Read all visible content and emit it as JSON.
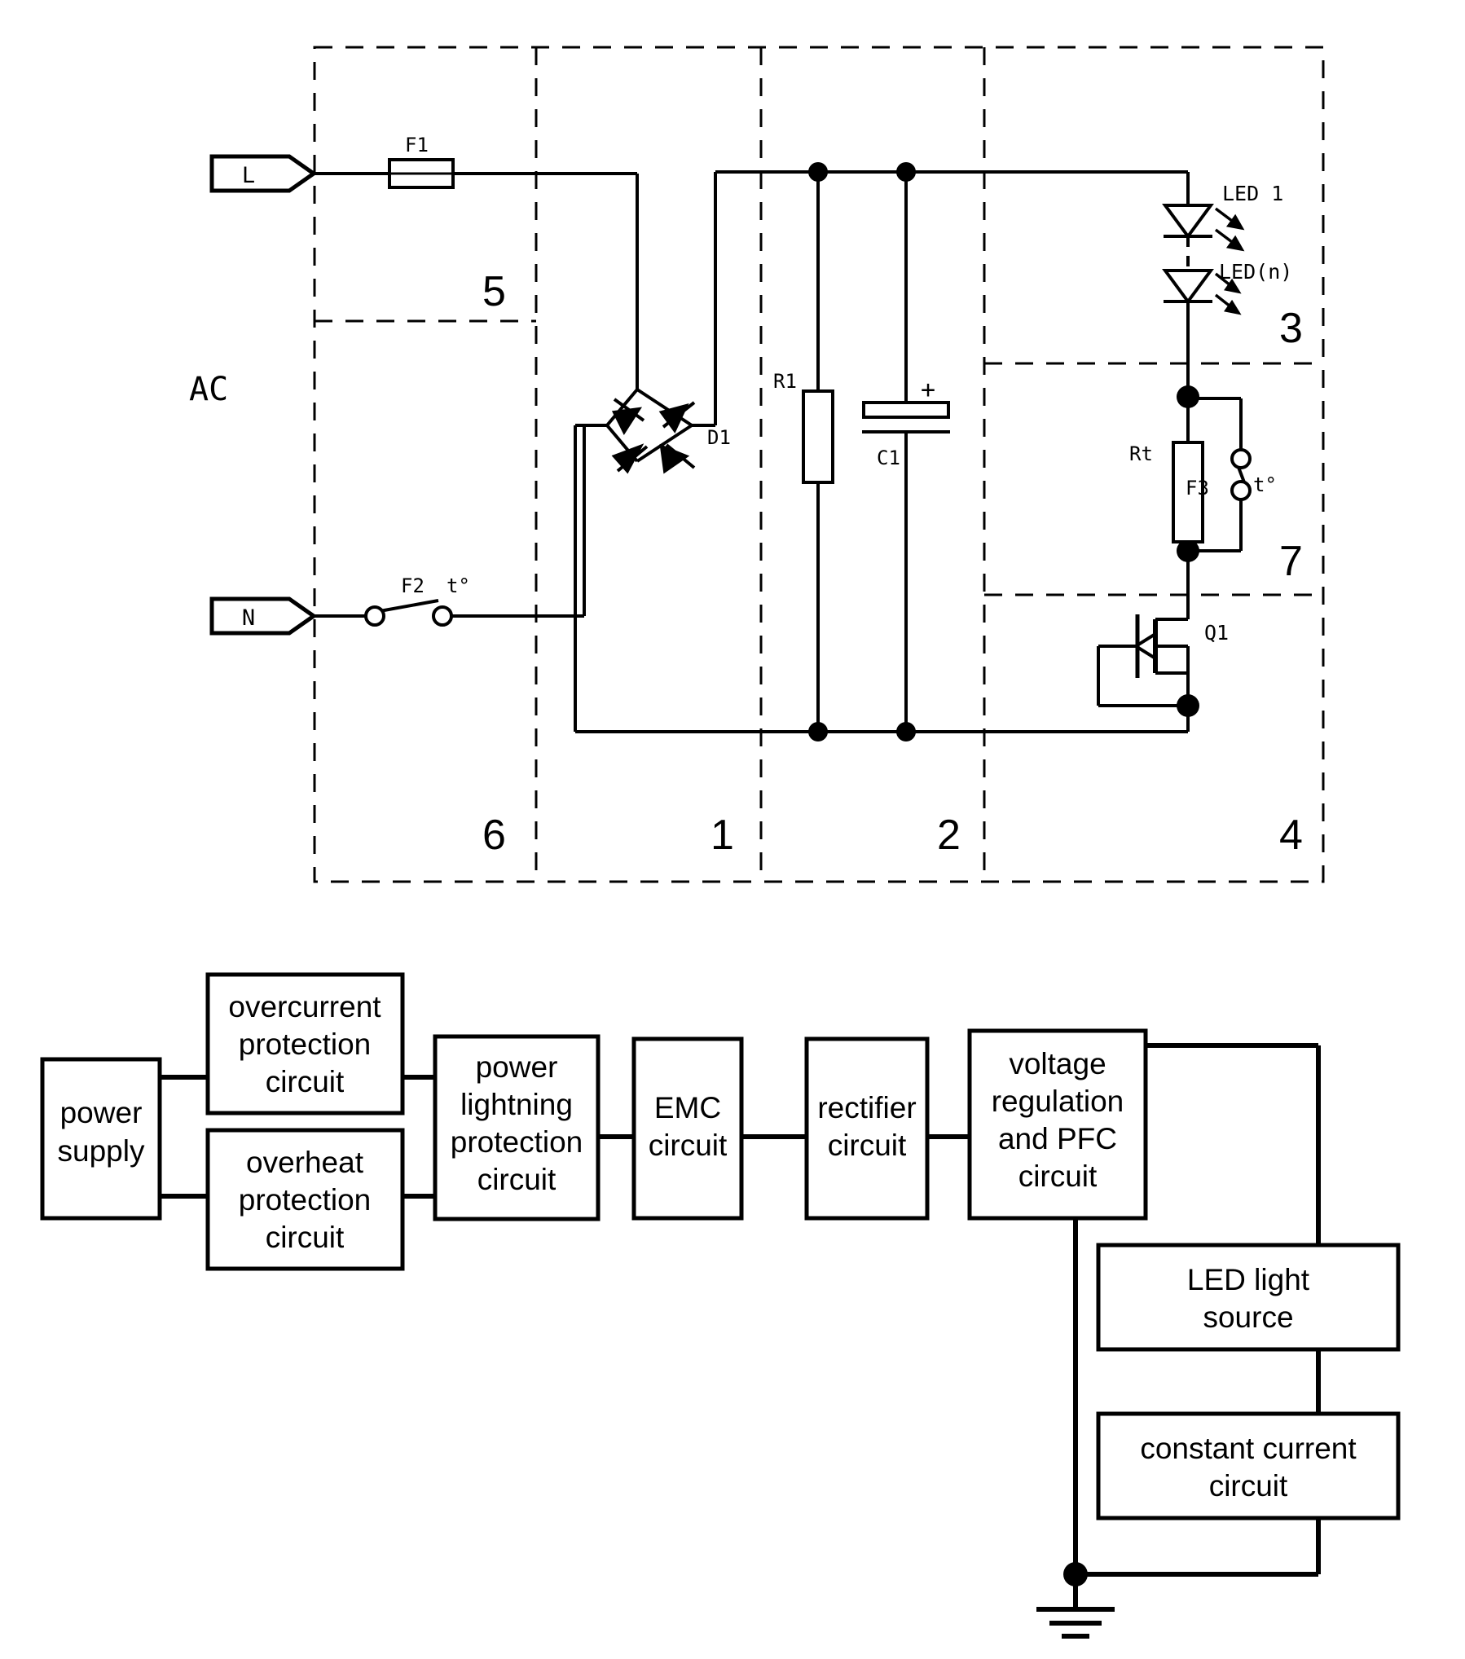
{
  "document": {
    "type": "patent-figure",
    "title": "LED driver protection circuit schematic and functional block diagram"
  },
  "schematic": {
    "source_label": "AC",
    "terminals": [
      {
        "id": "terminal-l",
        "label": "L"
      },
      {
        "id": "terminal-n",
        "label": "N"
      }
    ],
    "components": [
      {
        "id": "f1",
        "label": "F1",
        "kind": "fuse"
      },
      {
        "id": "f2",
        "label": "F2",
        "sub": "t°",
        "kind": "thermal-switch"
      },
      {
        "id": "d1",
        "label": "D1",
        "kind": "bridge-rectifier"
      },
      {
        "id": "r1",
        "label": "R1",
        "kind": "resistor"
      },
      {
        "id": "c1",
        "label": "C1",
        "polarity": "+",
        "kind": "polarized-capacitor"
      },
      {
        "id": "led1",
        "label": "LED 1",
        "kind": "led"
      },
      {
        "id": "ledn",
        "label": "LED(n)",
        "kind": "led"
      },
      {
        "id": "rt",
        "label": "Rt",
        "kind": "resistor"
      },
      {
        "id": "f3",
        "label": "F3",
        "sub": "t°",
        "kind": "thermal-switch"
      },
      {
        "id": "q1",
        "label": "Q1",
        "kind": "mosfet"
      }
    ],
    "region_labels": [
      {
        "id": "region-5",
        "label": "5"
      },
      {
        "id": "region-3",
        "label": "3"
      },
      {
        "id": "region-7",
        "label": "7"
      },
      {
        "id": "region-6",
        "label": "6"
      },
      {
        "id": "region-1",
        "label": "1"
      },
      {
        "id": "region-2",
        "label": "2"
      },
      {
        "id": "region-4",
        "label": "4"
      }
    ]
  },
  "block_diagram": {
    "blocks": [
      {
        "id": "power-supply",
        "label": "power\nsupply"
      },
      {
        "id": "overcurrent-protection",
        "label": "overcurrent\nprotection\ncircuit"
      },
      {
        "id": "overheat-protection",
        "label": "overheat\nprotection\ncircuit"
      },
      {
        "id": "power-lightning-protection",
        "label": "power\nlightning\nprotection\ncircuit"
      },
      {
        "id": "emc",
        "label": "EMC\ncircuit"
      },
      {
        "id": "rectifier",
        "label": "rectifier\ncircuit"
      },
      {
        "id": "voltage-regulation-pfc",
        "label": "voltage\nregulation\nand PFC\ncircuit"
      },
      {
        "id": "led-light-source",
        "label": "LED light\nsource"
      },
      {
        "id": "constant-current",
        "label": "constant current\ncircuit"
      }
    ],
    "ground_symbol": "earth-ground"
  },
  "colors": {
    "ink": "#000000",
    "paper": "#ffffff"
  }
}
